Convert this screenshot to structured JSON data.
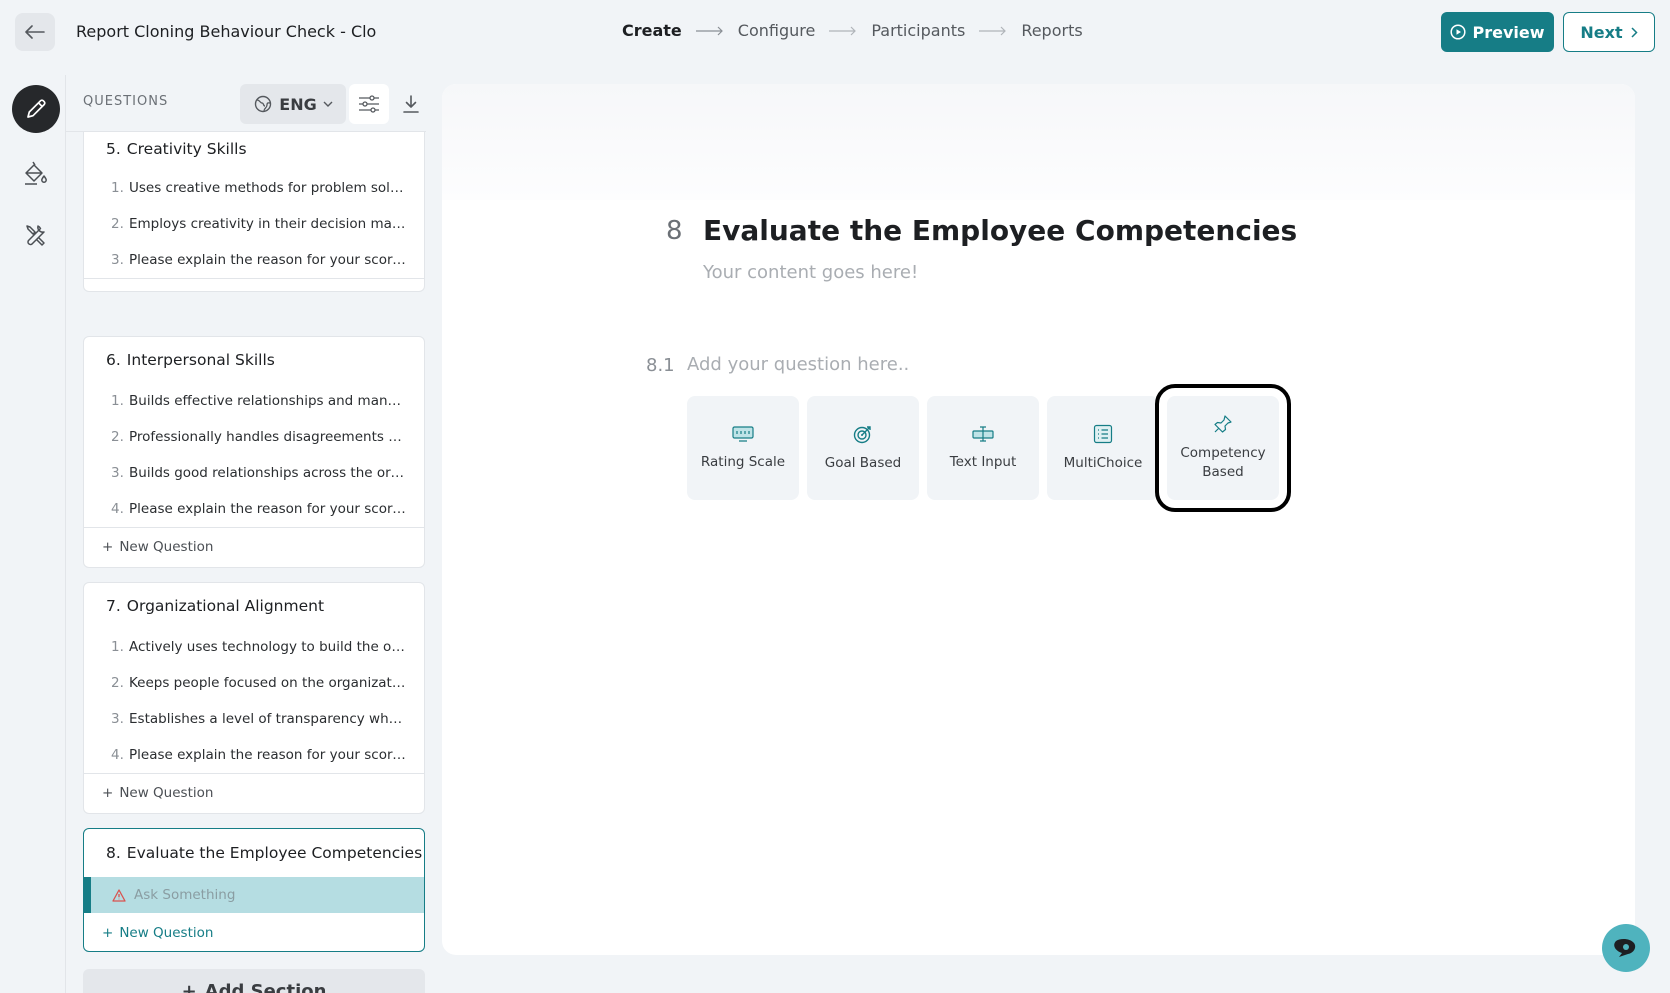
{
  "header": {
    "title": "Report Cloning Behaviour Check - Clo",
    "steps": [
      "Create",
      "Configure",
      "Participants",
      "Reports"
    ],
    "preview_label": "Preview",
    "next_label": "Next"
  },
  "panel": {
    "label": "QUESTIONS",
    "language": "ENG",
    "add_section_label": "Add Section",
    "new_question_label": "New Question",
    "sections": [
      {
        "num": "5.",
        "title": "Creativity Skills",
        "questions": [
          {
            "n": "1.",
            "text": "Uses creative methods for problem solving"
          },
          {
            "n": "2.",
            "text": "Employs creativity in their decision making"
          },
          {
            "n": "3.",
            "text": "Please explain the reason for your scores in this section"
          }
        ]
      },
      {
        "num": "6.",
        "title": "Interpersonal Skills",
        "questions": [
          {
            "n": "1.",
            "text": "Builds effective relationships and managing conflict"
          },
          {
            "n": "2.",
            "text": "Professionally handles disagreements between people"
          },
          {
            "n": "3.",
            "text": "Builds good relationships across the organization"
          },
          {
            "n": "4.",
            "text": "Please explain the reason for your scores in this section"
          }
        ]
      },
      {
        "num": "7.",
        "title": "Organizational Alignment",
        "questions": [
          {
            "n": "1.",
            "text": "Actively uses technology to build the organization"
          },
          {
            "n": "2.",
            "text": "Keeps people focused on the organizational goals"
          },
          {
            "n": "3.",
            "text": "Establishes a level of transparency when communicating"
          },
          {
            "n": "4.",
            "text": "Please explain the reason for your scores in this section"
          }
        ]
      },
      {
        "num": "8.",
        "title": "Evaluate the Employee Competencies",
        "questions": [
          {
            "n": "",
            "text": "Ask Something"
          }
        ]
      }
    ]
  },
  "editor": {
    "section_number": "8",
    "section_title": "Evaluate the Employee Competencies",
    "section_description": "Your content goes here!",
    "question_number": "8.1",
    "question_placeholder": "Add your question here..",
    "types": [
      {
        "label": "Rating Scale",
        "icon": "rating-scale-icon"
      },
      {
        "label": "Goal Based",
        "icon": "target-icon"
      },
      {
        "label": "Text Input",
        "icon": "text-input-icon"
      },
      {
        "label": "MultiChoice",
        "icon": "list-icon"
      },
      {
        "label": "Competency Based",
        "icon": "pin-icon"
      }
    ]
  },
  "colors": {
    "accent": "#167d86",
    "selected_row": "#b5dde2",
    "help": "#4fb3be"
  }
}
